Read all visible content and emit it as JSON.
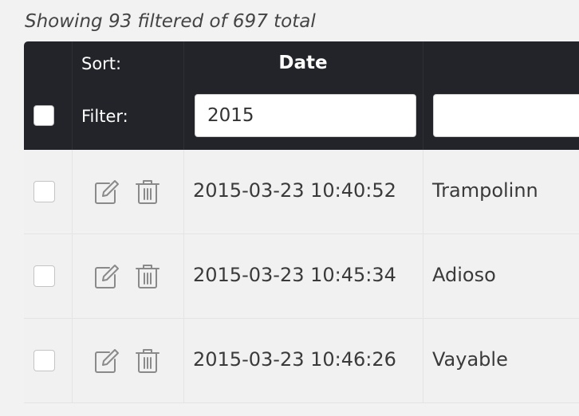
{
  "summary": "Showing 93 filtered of 697 total",
  "header": {
    "sort_label": "Sort:",
    "filter_label": "Filter:",
    "columns": [
      {
        "title": "Date",
        "filter_value": "2015"
      },
      {
        "title": "",
        "filter_value": ""
      }
    ]
  },
  "icons": {
    "edit": "edit-icon",
    "delete": "trash-icon"
  },
  "rows": [
    {
      "date": "2015-03-23 10:40:52",
      "name": "Trampolinn"
    },
    {
      "date": "2015-03-23 10:45:34",
      "name": "Adioso"
    },
    {
      "date": "2015-03-23 10:46:26",
      "name": "Vayable"
    }
  ],
  "colors": {
    "header_bg": "#222429",
    "row_bg": "#f1f1f1",
    "page_bg": "#f2f2f2"
  }
}
